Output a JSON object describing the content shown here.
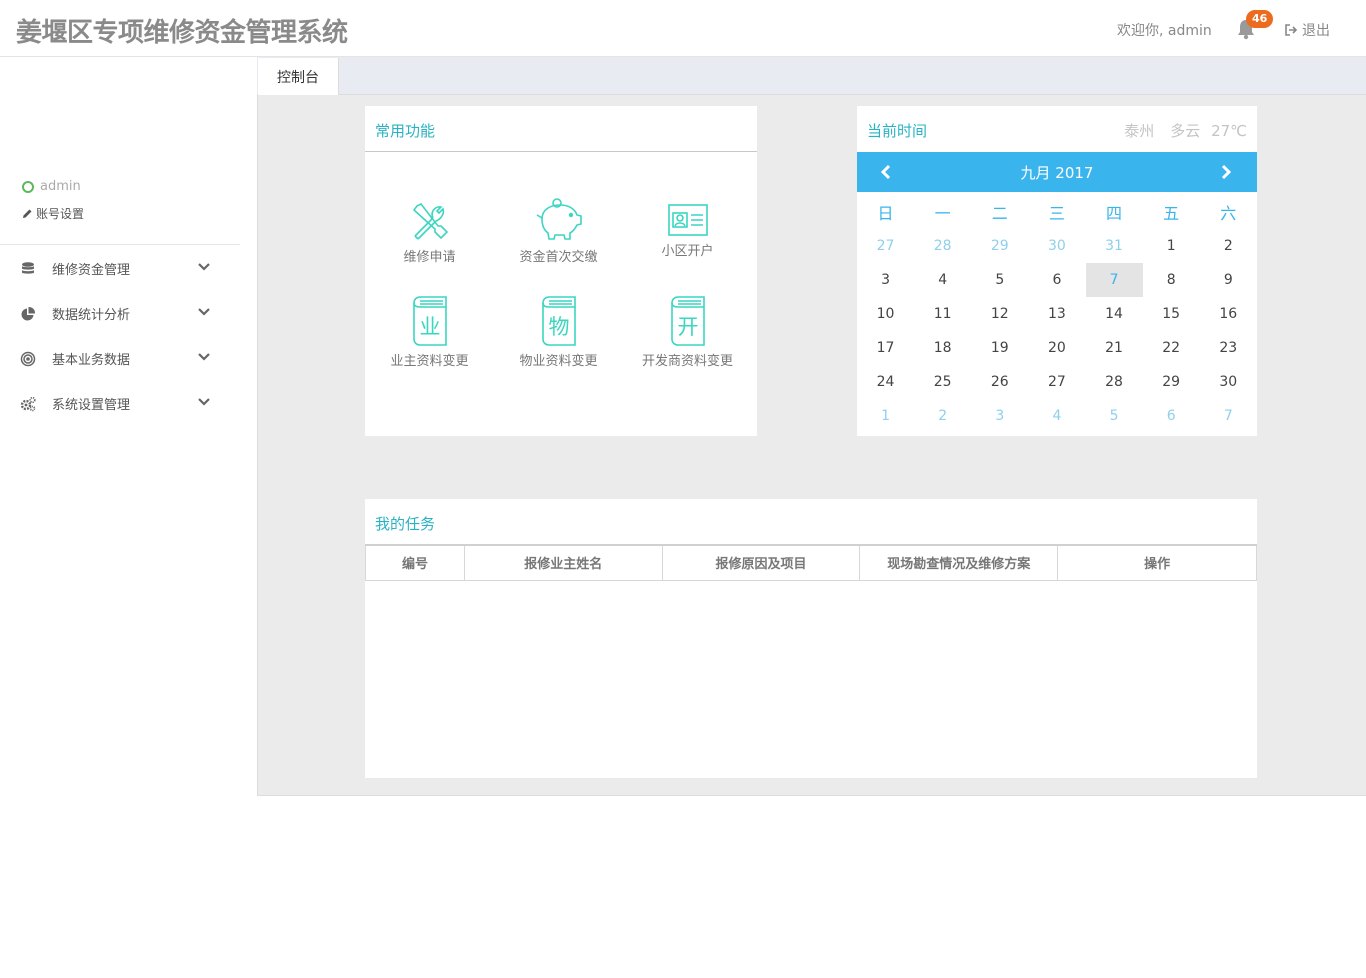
{
  "header": {
    "title": "姜堰区专项维修资金管理系统",
    "welcome": "欢迎你, admin",
    "notification_count": "46",
    "logout_label": "退出"
  },
  "sidebar": {
    "username": "admin",
    "account_settings": "账号设置",
    "items": [
      {
        "label": "维修资金管理",
        "icon": "database-icon"
      },
      {
        "label": "数据统计分析",
        "icon": "pie-chart-icon"
      },
      {
        "label": "基本业务数据",
        "icon": "target-icon"
      },
      {
        "label": "系统设置管理",
        "icon": "gears-icon"
      }
    ]
  },
  "tabs": [
    {
      "label": "控制台"
    }
  ],
  "functions": {
    "title": "常用功能",
    "items": [
      {
        "label": "维修申请",
        "icon": "tools-icon"
      },
      {
        "label": "资金首次交缴",
        "icon": "piggy-bank-icon"
      },
      {
        "label": "小区开户",
        "icon": "id-card-icon"
      },
      {
        "label": "业主资料变更",
        "icon": "book-icon",
        "glyph": "业"
      },
      {
        "label": "物业资料变更",
        "icon": "book-icon",
        "glyph": "物"
      },
      {
        "label": "开发商资料变更",
        "icon": "book-icon",
        "glyph": "开"
      }
    ]
  },
  "calendar": {
    "title": "当前时间",
    "city": "泰州",
    "weather": "多云",
    "temperature": "27℃",
    "month_label": "九月 2017",
    "weekdays": [
      "日",
      "一",
      "二",
      "三",
      "四",
      "五",
      "六"
    ],
    "today": "7",
    "weeks": [
      [
        "27",
        "28",
        "29",
        "30",
        "31",
        "1",
        "2"
      ],
      [
        "3",
        "4",
        "5",
        "6",
        "7",
        "8",
        "9"
      ],
      [
        "10",
        "11",
        "12",
        "13",
        "14",
        "15",
        "16"
      ],
      [
        "17",
        "18",
        "19",
        "20",
        "21",
        "22",
        "23"
      ],
      [
        "24",
        "25",
        "26",
        "27",
        "28",
        "29",
        "30"
      ],
      [
        "1",
        "2",
        "3",
        "4",
        "5",
        "6",
        "7"
      ]
    ]
  },
  "tasks": {
    "title": "我的任务",
    "columns": [
      "编号",
      "报修业主姓名",
      "报修原因及项目",
      "现场勘查情况及维修方案",
      "操作"
    ]
  },
  "colors": {
    "accent": "#29b3c2",
    "calendar_header": "#3ab4ec",
    "icon_teal": "#3ad6c0",
    "badge": "#ed6b1e"
  }
}
